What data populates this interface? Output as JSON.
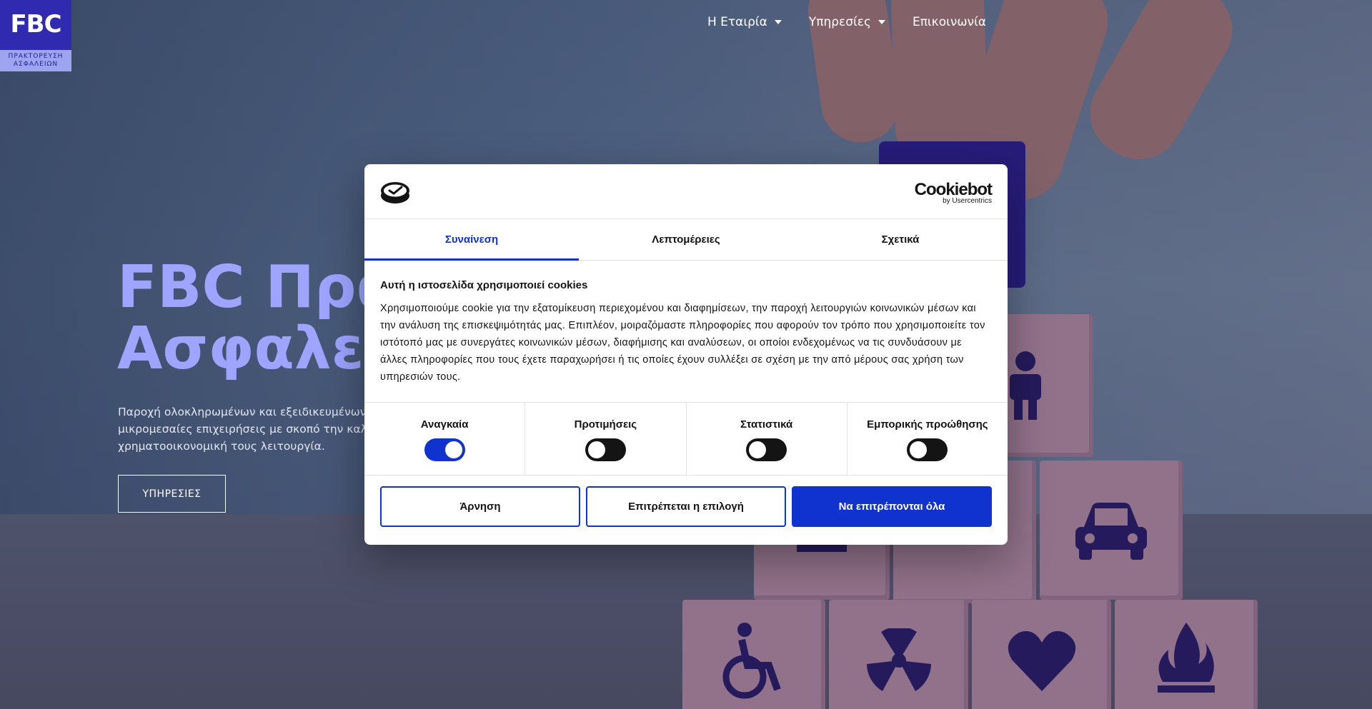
{
  "logo": {
    "text": "FBC",
    "sub_line1": "ΠΡΑΚΤΟΡΕΥΣΗ",
    "sub_line2": "ΑΣΦΑΛΕΙΩΝ"
  },
  "nav": {
    "items": [
      {
        "label": "Η Εταιρία",
        "has_dropdown": true
      },
      {
        "label": "Υπηρεσίες",
        "has_dropdown": true
      },
      {
        "label": "Επικοινωνία",
        "has_dropdown": false
      }
    ]
  },
  "hero": {
    "title_line1": "FBC Πρα",
    "title_line2": "Ασφαλει",
    "desc_line1": "Παροχή ολοκληρωμένων και εξειδικευμένων υ",
    "desc_line2": "μικρομεσαίες επιχειρήσεις με σκοπό την καλύτ",
    "desc_line3": "χρηματοοικονομική τους λειτουργία.",
    "button": "ΥΠΗΡΕΣΙΕΣ"
  },
  "cookie_dialog": {
    "brand_name": "Cookiebot",
    "brand_by": "by Usercentrics",
    "tabs": [
      {
        "label": "Συναίνεση",
        "active": true
      },
      {
        "label": "Λεπτομέρειες",
        "active": false
      },
      {
        "label": "Σχετικά",
        "active": false
      }
    ],
    "heading": "Αυτή η ιστοσελίδα χρησιμοποιεί cookies",
    "text": "Χρησιμοποιούμε cookie για την εξατομίκευση περιεχομένου και διαφημίσεων, την παροχή λειτουργιών κοινωνικών μέσων και την ανάλυση της επισκεψιμότητάς μας. Επιπλέον, μοιραζόμαστε πληροφορίες που αφορούν τον τρόπο που χρησιμοποιείτε τον ιστότοπό μας με συνεργάτες κοινωνικών μέσων, διαφήμισης και αναλύσεων, οι οποίοι ενδεχομένως να τις συνδυάσουν με άλλες πληροφορίες που τους έχετε παραχωρήσει ή τις οποίες έχουν συλλέξει σε σχέση με την από μέρους σας χρήση των υπηρεσιών τους.",
    "toggles": [
      {
        "label": "Αναγκαία",
        "on": true
      },
      {
        "label": "Προτιμήσεις",
        "on": false
      },
      {
        "label": "Στατιστικά",
        "on": false
      },
      {
        "label": "Εμπορικής προώθησης",
        "on": false
      }
    ],
    "buttons": {
      "deny": "Άρνηση",
      "allow_selection": "Επιτρέπεται η επιλογή",
      "allow_all": "Να επιτρέπονται όλα"
    }
  },
  "colors": {
    "accent": "#1032cf",
    "logo_bg": "#2f2ab0",
    "hero_title": "#9ea4ff"
  }
}
